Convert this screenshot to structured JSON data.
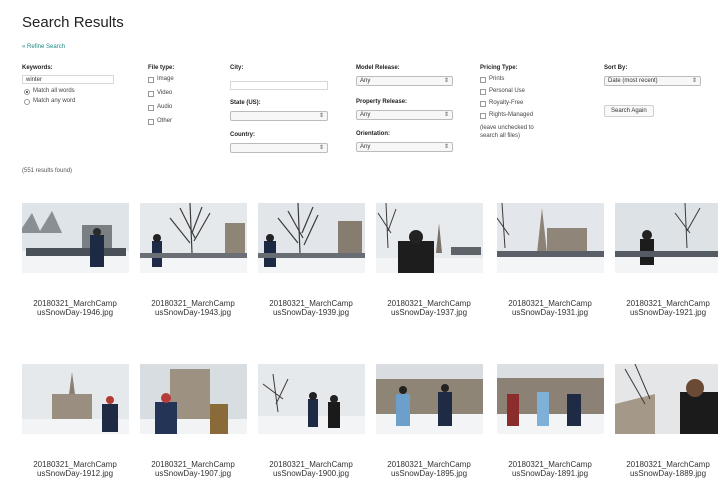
{
  "header": {
    "title": "Search Results",
    "refine_link": "« Refine Search"
  },
  "form": {
    "keywords": {
      "label": "Keywords:",
      "value": "winter",
      "options": [
        "Match all words",
        "Match any word"
      ],
      "selected": 0
    },
    "file_type": {
      "label": "File type:",
      "options": [
        "Image",
        "Video",
        "Audio",
        "Other"
      ]
    },
    "city": {
      "label": "City:",
      "value": ""
    },
    "state": {
      "label": "State (US):",
      "value": ""
    },
    "country": {
      "label": "Country:",
      "value": ""
    },
    "model_release": {
      "label": "Model Release:",
      "value": "Any"
    },
    "property_release": {
      "label": "Property Release:",
      "value": "Any"
    },
    "orientation": {
      "label": "Orientation:",
      "value": "Any"
    },
    "pricing": {
      "label": "Pricing Type:",
      "options": [
        "Prints",
        "Personal Use",
        "Royalty-Free",
        "Rights-Managed"
      ],
      "note": "(leave unchecked to search all files)"
    },
    "sort": {
      "label": "Sort By:",
      "value": "Date (most recent)"
    },
    "search_again": "Search Again"
  },
  "results": {
    "count_text": "(551 results found)",
    "items": [
      {
        "name": "20180321_MarchCampusSnowDay-1946.jpg",
        "line1": "20180321_MarchCamp",
        "line2": "usSnowDay-1946.jpg"
      },
      {
        "name": "20180321_MarchCampusSnowDay-1943.jpg",
        "line1": "20180321_MarchCamp",
        "line2": "usSnowDay-1943.jpg"
      },
      {
        "name": "20180321_MarchCampusSnowDay-1939.jpg",
        "line1": "20180321_MarchCamp",
        "line2": "usSnowDay-1939.jpg"
      },
      {
        "name": "20180321_MarchCampusSnowDay-1937.jpg",
        "line1": "20180321_MarchCamp",
        "line2": "usSnowDay-1937.jpg"
      },
      {
        "name": "20180321_MarchCampusSnowDay-1931.jpg",
        "line1": "20180321_MarchCamp",
        "line2": "usSnowDay-1931.jpg"
      },
      {
        "name": "20180321_MarchCampusSnowDay-1921.jpg",
        "line1": "20180321_MarchCamp",
        "line2": "usSnowDay-1921.jpg"
      },
      {
        "name": "20180321_MarchCampusSnowDay-1912.jpg",
        "line1": "20180321_MarchCamp",
        "line2": "usSnowDay-1912.jpg"
      },
      {
        "name": "20180321_MarchCampusSnowDay-1907.jpg",
        "line1": "20180321_MarchCamp",
        "line2": "usSnowDay-1907.jpg"
      },
      {
        "name": "20180321_MarchCampusSnowDay-1900.jpg",
        "line1": "20180321_MarchCamp",
        "line2": "usSnowDay-1900.jpg"
      },
      {
        "name": "20180321_MarchCampusSnowDay-1895.jpg",
        "line1": "20180321_MarchCamp",
        "line2": "usSnowDay-1895.jpg"
      },
      {
        "name": "20180321_MarchCampusSnowDay-1891.jpg",
        "line1": "20180321_MarchCamp",
        "line2": "usSnowDay-1891.jpg"
      },
      {
        "name": "20180321_MarchCampusSnowDay-1889.jpg",
        "line1": "20180321_MarchCamp",
        "line2": "usSnowDay-1889.jpg"
      }
    ]
  },
  "colors": {
    "accent": "#1f8a87",
    "text": "#333333"
  }
}
